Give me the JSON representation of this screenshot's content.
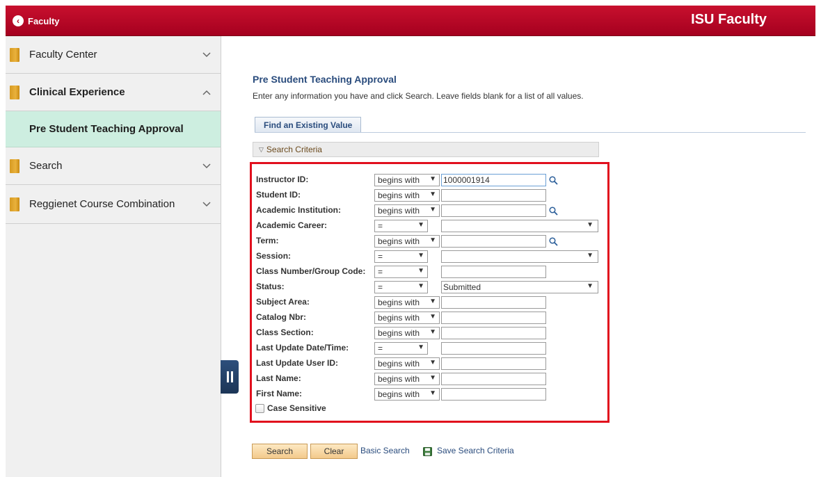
{
  "header": {
    "back_label": "Faculty",
    "brand": "ISU Faculty"
  },
  "sidebar": {
    "items": [
      {
        "label": "Faculty Center"
      },
      {
        "label": "Clinical Experience"
      },
      {
        "label": "Pre Student Teaching Approval"
      },
      {
        "label": "Search"
      },
      {
        "label": "Reggienet Course Combination"
      }
    ]
  },
  "main": {
    "title": "Pre Student Teaching Approval",
    "instructions": "Enter any information you have and click Search. Leave fields blank for a list of all values.",
    "tab_label": "Find an Existing Value",
    "criteria_label": "Search Criteria",
    "fields": [
      {
        "label": "Instructor ID:",
        "operator": "begins with",
        "value": "1000001914"
      },
      {
        "label": "Student ID:",
        "operator": "begins with",
        "value": ""
      },
      {
        "label": "Academic Institution:",
        "operator": "begins with",
        "value": ""
      },
      {
        "label": "Academic Career:",
        "operator": "=",
        "value": ""
      },
      {
        "label": "Term:",
        "operator": "begins with",
        "value": ""
      },
      {
        "label": "Session:",
        "operator": "=",
        "value": ""
      },
      {
        "label": "Class Number/Group Code:",
        "operator": "=",
        "value": ""
      },
      {
        "label": "Status:",
        "operator": "=",
        "value": "Submitted"
      },
      {
        "label": "Subject Area:",
        "operator": "begins with",
        "value": ""
      },
      {
        "label": "Catalog Nbr:",
        "operator": "begins with",
        "value": ""
      },
      {
        "label": "Class Section:",
        "operator": "begins with",
        "value": ""
      },
      {
        "label": "Last Update Date/Time:",
        "operator": "=",
        "value": ""
      },
      {
        "label": "Last Update User ID:",
        "operator": "begins with",
        "value": ""
      },
      {
        "label": "Last Name:",
        "operator": "begins with",
        "value": ""
      },
      {
        "label": "First Name:",
        "operator": "begins with",
        "value": ""
      }
    ],
    "case_sensitive_label": "Case Sensitive",
    "buttons": {
      "search": "Search",
      "clear": "Clear",
      "basic_search": "Basic Search",
      "save_criteria": "Save Search Criteria"
    }
  },
  "icons": {
    "back": "chevron-left-icon",
    "folder": "folder-icon",
    "lookup": "magnifier-icon",
    "save": "floppy-disk-icon"
  },
  "colors": {
    "header_red": "#b5001f",
    "highlight_box": "#e10f1d",
    "nav_selected": "#cdeee0",
    "title_blue": "#2a4c7d"
  }
}
